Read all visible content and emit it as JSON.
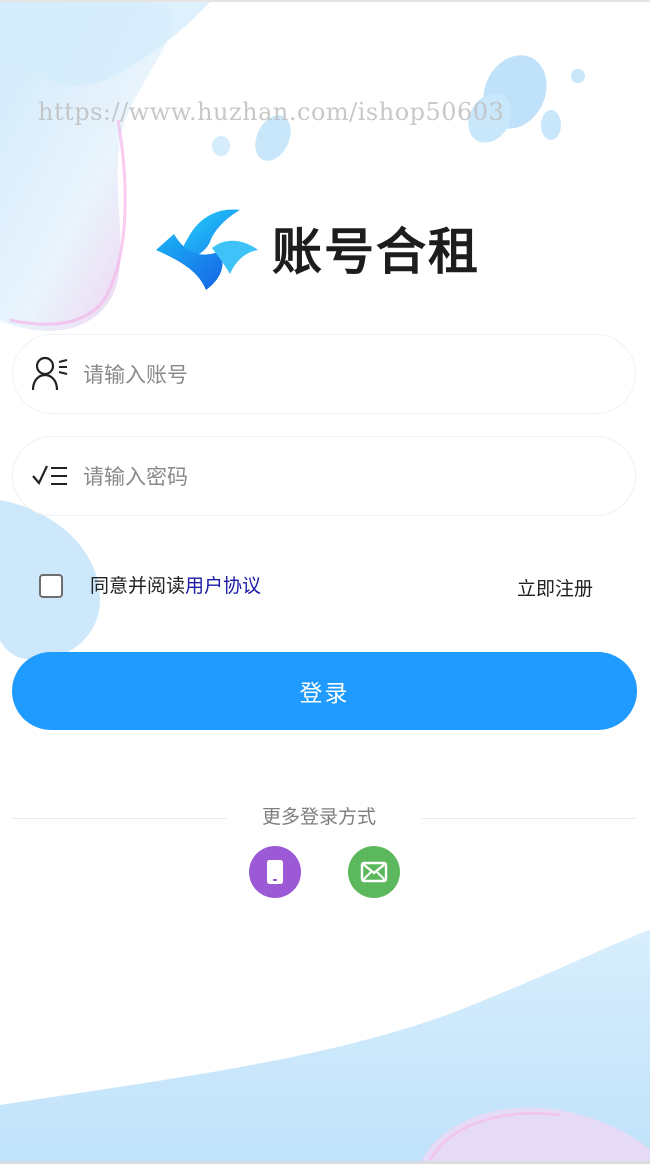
{
  "watermark": "https://www.huzhan.com/ishop50603",
  "logo": {
    "text": "账号合租"
  },
  "account": {
    "placeholder": "请输入账号"
  },
  "password": {
    "placeholder": "请输入密码"
  },
  "agreement": {
    "prefix": "同意并阅读",
    "link": "用户协议"
  },
  "register_label": "立即注册",
  "login_label": "登录",
  "more_login_label": "更多登录方式",
  "icons": {
    "account": "user-icon",
    "password": "check-list-icon",
    "phone": "phone-icon",
    "email": "email-icon",
    "logo": "logo-mark-icon"
  },
  "colors": {
    "primary": "#1f9bff",
    "phone_circle": "#9b59d6",
    "email_circle": "#5cb85c",
    "link": "#1a1aa6"
  }
}
